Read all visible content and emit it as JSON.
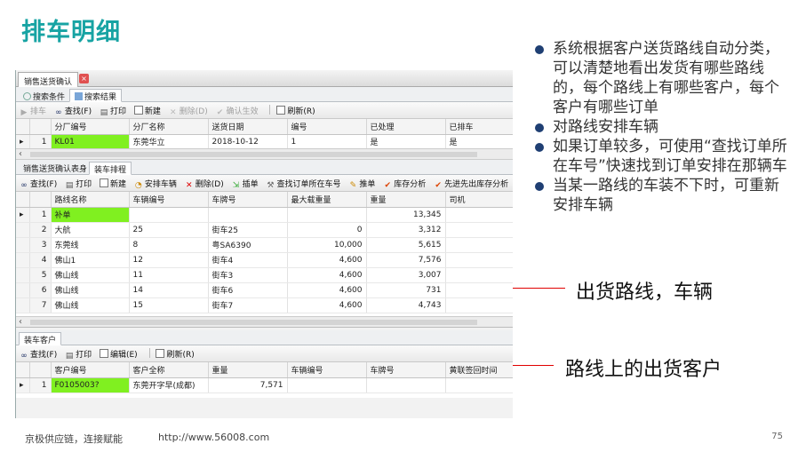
{
  "slide": {
    "title": "排车明细",
    "bullets": [
      "系统根据客户送货路线自动分类，可以清楚地看出发货有哪些路线的，每个路线上有哪些客户，每个客户有哪些订单",
      "对路线安排车辆",
      "如果订单较多，可使用“查找订单所在车号”快速找到订单安排在那辆车",
      "当某一路线的车装不下时，可重新安排车辆"
    ],
    "callout_1": "出货路线，车辆",
    "callout_2": "路线上的出货客户",
    "footer_text": "京极供应链，连接赋能",
    "footer_url": "http://www.56008.com",
    "page_number": "75",
    "accent_color": "#17a3a3",
    "arrow_color": "#e00000"
  },
  "app": {
    "doc_tab": "销售送货确认",
    "search_tabs": [
      "搜索条件",
      "搜索结果"
    ],
    "toolbar1": [
      {
        "label": "排车",
        "icon": "play-icon",
        "disabled": true
      },
      {
        "label": "查找(F)",
        "icon": "binoculars-icon",
        "disabled": false
      },
      {
        "label": "打印",
        "icon": "printer-icon",
        "disabled": false
      },
      {
        "label": "新建",
        "icon": "new-document-icon",
        "disabled": false
      },
      {
        "label": "删除(D)",
        "icon": "delete-icon",
        "disabled": true
      },
      {
        "label": "确认生效",
        "icon": "check-icon",
        "disabled": true
      },
      {
        "label": "刷新(R)",
        "icon": "refresh-icon",
        "disabled": false
      }
    ],
    "grid1": {
      "columns": [
        "分厂编号",
        "分厂名称",
        "送货日期",
        "编号",
        "已处理",
        "已排车"
      ],
      "rows": [
        {
          "rownum": "1",
          "cells": [
            "KL01",
            "东莞华立",
            "2018-10-12",
            "1",
            "是",
            "是"
          ]
        }
      ]
    },
    "mid_tabs": [
      "销售送货确认表身",
      "装车排程"
    ],
    "toolbar2": [
      {
        "label": "查找(F)",
        "icon": "binoculars-icon"
      },
      {
        "label": "打印",
        "icon": "printer-icon"
      },
      {
        "label": "新建",
        "icon": "new-document-icon"
      },
      {
        "label": "安排车辆",
        "icon": "schedule-icon"
      },
      {
        "label": "删除(D)",
        "icon": "delete-icon"
      },
      {
        "label": "插单",
        "icon": "insert-icon"
      },
      {
        "label": "查找订单所在车号",
        "icon": "search-tools-icon"
      },
      {
        "label": "推单",
        "icon": "push-icon"
      },
      {
        "label": "库存分析",
        "icon": "check-icon"
      },
      {
        "label": "先进先出库存分析",
        "icon": "check-icon"
      }
    ],
    "grid2": {
      "columns": [
        "路线名称",
        "车辆编号",
        "车牌号",
        "最大载重量",
        "重量",
        "司机"
      ],
      "rows": [
        {
          "rownum": "1",
          "route": "补单",
          "vehicle_no": "",
          "plate": "",
          "max_load": "",
          "weight": "13,345",
          "driver": "",
          "current": true
        },
        {
          "rownum": "2",
          "route": "大航",
          "vehicle_no": "25",
          "plate": "街车25",
          "max_load": "0",
          "weight": "3,312",
          "driver": "",
          "current": false
        },
        {
          "rownum": "3",
          "route": "东莞线",
          "vehicle_no": "8",
          "plate": "粤SA6390",
          "max_load": "10,000",
          "weight": "5,615",
          "driver": "",
          "current": false
        },
        {
          "rownum": "4",
          "route": "佛山1",
          "vehicle_no": "12",
          "plate": "街车4",
          "max_load": "4,600",
          "weight": "7,576",
          "driver": "",
          "current": false
        },
        {
          "rownum": "5",
          "route": "佛山线",
          "vehicle_no": "11",
          "plate": "街车3",
          "max_load": "4,600",
          "weight": "3,007",
          "driver": "",
          "current": false
        },
        {
          "rownum": "6",
          "route": "佛山线",
          "vehicle_no": "14",
          "plate": "街车6",
          "max_load": "4,600",
          "weight": "731",
          "driver": "",
          "current": false
        },
        {
          "rownum": "7",
          "route": "佛山线",
          "vehicle_no": "15",
          "plate": "街车7",
          "max_load": "4,600",
          "weight": "4,743",
          "driver": "",
          "current": false
        }
      ]
    },
    "bottom_tab": "装车客户",
    "toolbar3": [
      {
        "label": "查找(F)",
        "icon": "binoculars-icon"
      },
      {
        "label": "打印",
        "icon": "printer-icon"
      },
      {
        "label": "编辑(E)",
        "icon": "edit-icon"
      },
      {
        "label": "刷新(R)",
        "icon": "refresh-icon"
      }
    ],
    "grid3": {
      "columns": [
        "客户编号",
        "客户全称",
        "重量",
        "车辆编号",
        "车牌号",
        "黄联签回时间"
      ],
      "rows": [
        {
          "rownum": "1",
          "cells": [
            "F0105003?",
            "东莞开字早(成都)",
            "7,571",
            "",
            "",
            ""
          ]
        }
      ]
    }
  }
}
